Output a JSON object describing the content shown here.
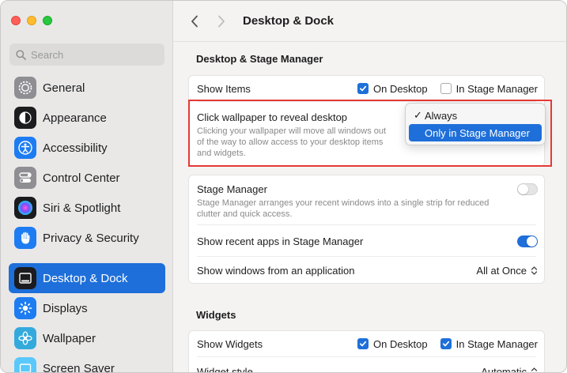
{
  "window": {
    "title": "Desktop & Dock"
  },
  "search": {
    "placeholder": "Search"
  },
  "sidebar": {
    "items": [
      {
        "label": "General",
        "icon": "gear-icon"
      },
      {
        "label": "Appearance",
        "icon": "appearance-icon"
      },
      {
        "label": "Accessibility",
        "icon": "accessibility-icon"
      },
      {
        "label": "Control Center",
        "icon": "control-center-icon"
      },
      {
        "label": "Siri & Spotlight",
        "icon": "siri-icon"
      },
      {
        "label": "Privacy & Security",
        "icon": "hand-icon"
      },
      {
        "label": "Desktop & Dock",
        "icon": "desktop-dock-icon",
        "active": true
      },
      {
        "label": "Displays",
        "icon": "displays-icon"
      },
      {
        "label": "Wallpaper",
        "icon": "wallpaper-icon"
      },
      {
        "label": "Screen Saver",
        "icon": "screen-saver-icon"
      }
    ]
  },
  "section1": {
    "heading": "Desktop & Stage Manager",
    "show_items": {
      "label": "Show Items",
      "on_desktop": "On Desktop",
      "on_desktop_checked": true,
      "in_stage_manager": "In Stage Manager",
      "in_stage_manager_checked": false
    },
    "click_wallpaper": {
      "label": "Click wallpaper to reveal desktop",
      "description_line1": "Clicking your wallpaper will move all windows out",
      "description_line2": "of the way to allow access to your desktop items",
      "description_line3": "and widgets.",
      "options": [
        "Always",
        "Only in Stage Manager"
      ],
      "checked_option": "Always",
      "highlighted_option": "Only in Stage Manager"
    },
    "stage_manager": {
      "label": "Stage Manager",
      "description_line1": "Stage Manager arranges your recent windows into a single strip for reduced",
      "description_line2": "clutter and quick access.",
      "enabled": false
    },
    "recent_apps": {
      "label": "Show recent apps in Stage Manager",
      "enabled": true
    },
    "show_windows": {
      "label": "Show windows from an application",
      "value": "All at Once"
    }
  },
  "section2": {
    "heading": "Widgets",
    "show_widgets": {
      "label": "Show Widgets",
      "on_desktop": "On Desktop",
      "on_desktop_checked": true,
      "in_stage_manager": "In Stage Manager",
      "in_stage_manager_checked": true
    },
    "widget_style": {
      "label": "Widget style",
      "value": "Automatic"
    }
  },
  "colors": {
    "accent": "#1e6fd9",
    "highlight_border": "#e53935"
  }
}
